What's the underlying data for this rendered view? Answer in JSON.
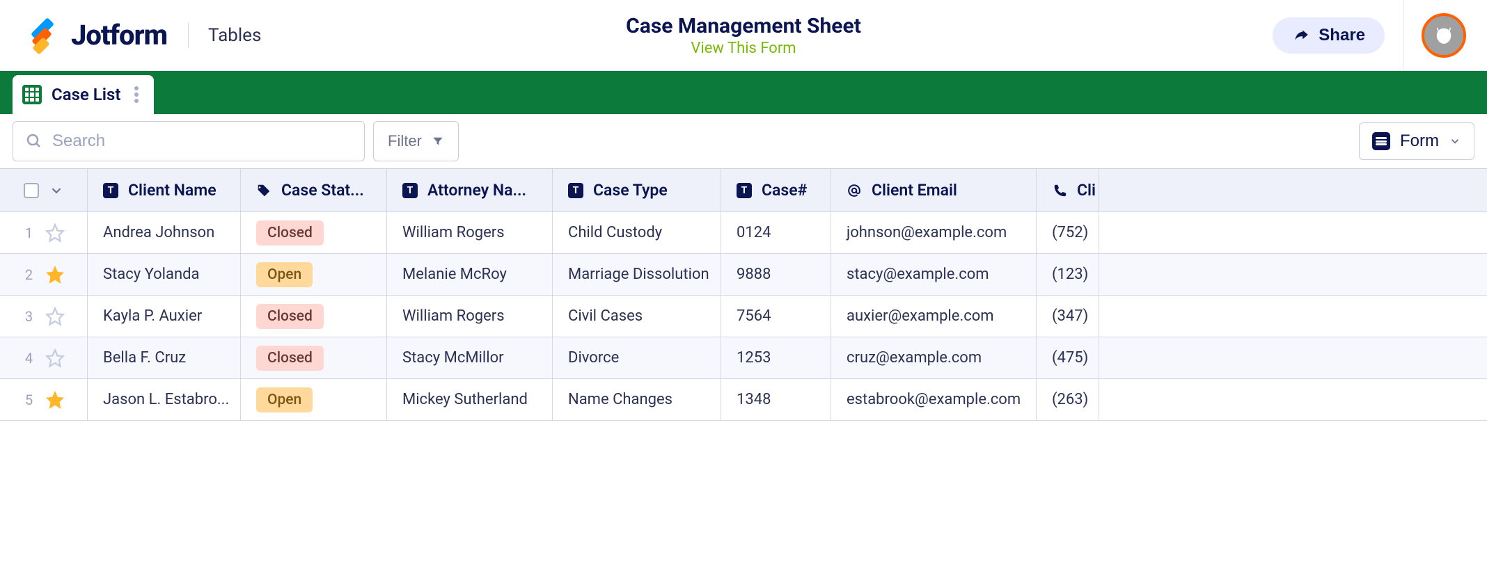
{
  "header": {
    "logo": "Jotform",
    "section": "Tables",
    "title": "Case Management Sheet",
    "view_link": "View This Form",
    "share_label": "Share"
  },
  "tab": {
    "label": "Case List"
  },
  "tools": {
    "search_placeholder": "Search",
    "filter_label": "Filter",
    "form_label": "Form"
  },
  "columns": [
    {
      "key": "client_name",
      "label": "Client Name",
      "icon": "text"
    },
    {
      "key": "case_status",
      "label": "Case Stat...",
      "icon": "tag"
    },
    {
      "key": "attorney_name",
      "label": "Attorney Na...",
      "icon": "text"
    },
    {
      "key": "case_type",
      "label": "Case Type",
      "icon": "text"
    },
    {
      "key": "case_no",
      "label": "Case#",
      "icon": "text"
    },
    {
      "key": "client_email",
      "label": "Client Email",
      "icon": "at"
    },
    {
      "key": "client_phone",
      "label": "Cli",
      "icon": "phone"
    }
  ],
  "rows": [
    {
      "n": "1",
      "starred": false,
      "client_name": "Andrea Johnson",
      "case_status": "Closed",
      "status_style": "closed",
      "attorney_name": "William Rogers",
      "case_type": "Child Custody",
      "case_no": "0124",
      "client_email": "johnson@example.com",
      "client_phone": "(752)"
    },
    {
      "n": "2",
      "starred": true,
      "client_name": "Stacy Yolanda",
      "case_status": "Open",
      "status_style": "open",
      "attorney_name": "Melanie McRoy",
      "case_type": "Marriage Dissolution",
      "case_no": "9888",
      "client_email": "stacy@example.com",
      "client_phone": "(123)"
    },
    {
      "n": "3",
      "starred": false,
      "client_name": "Kayla P. Auxier",
      "case_status": "Closed",
      "status_style": "closed",
      "attorney_name": "William Rogers",
      "case_type": "Civil Cases",
      "case_no": "7564",
      "client_email": "auxier@example.com",
      "client_phone": "(347)"
    },
    {
      "n": "4",
      "starred": false,
      "client_name": "Bella F. Cruz",
      "case_status": "Closed",
      "status_style": "closed",
      "attorney_name": "Stacy McMillor",
      "case_type": "Divorce",
      "case_no": "1253",
      "client_email": "cruz@example.com",
      "client_phone": "(475)"
    },
    {
      "n": "5",
      "starred": true,
      "client_name": "Jason L. Estabro...",
      "case_status": "Open",
      "status_style": "open",
      "attorney_name": "Mickey Sutherland",
      "case_type": "Name Changes",
      "case_no": "1348",
      "client_email": "estabrook@example.com",
      "client_phone": "(263)"
    }
  ]
}
